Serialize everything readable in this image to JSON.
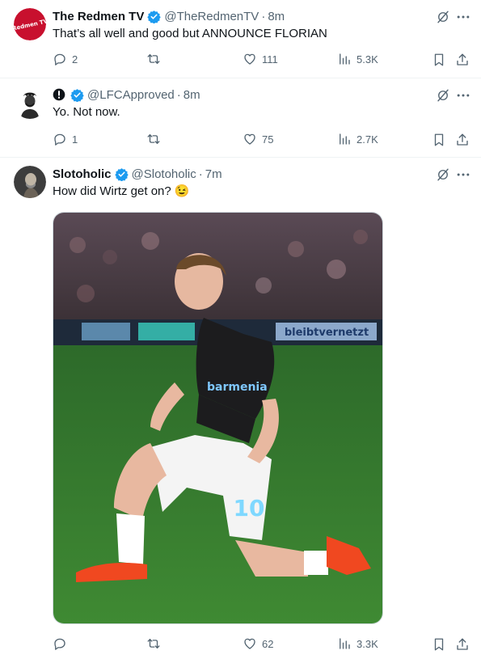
{
  "tweets": [
    {
      "name": "The Redmen TV",
      "handle": "@TheRedmenTV",
      "dot": "·",
      "time": "8m",
      "text": "That’s all well and good but ANNOUNCE FLORIAN",
      "avatar_text": "Redmen TV",
      "replies": "2",
      "likes": "111",
      "views": "5.3K"
    },
    {
      "name": "",
      "handle": "@LFCApproved",
      "dot": "·",
      "time": "8m",
      "text": "Yo. Not now.",
      "replies": "1",
      "likes": "75",
      "views": "2.7K"
    },
    {
      "name": "Slotoholic",
      "handle": "@Slotoholic",
      "dot": "·",
      "time": "7m",
      "text": "How did Wirtz get on?",
      "emoji": "😉",
      "replies": "",
      "likes": "62",
      "views": "3.3K",
      "photo": {
        "sponsor": "barmenia",
        "shirt_number": "10",
        "board_text": "bleibtvernetzt"
      }
    }
  ],
  "colors": {
    "text": "#0f1419",
    "secondary": "#536471",
    "verified": "#1d9bf0",
    "divider": "#eff3f4",
    "redmen_red": "#c8102e"
  }
}
